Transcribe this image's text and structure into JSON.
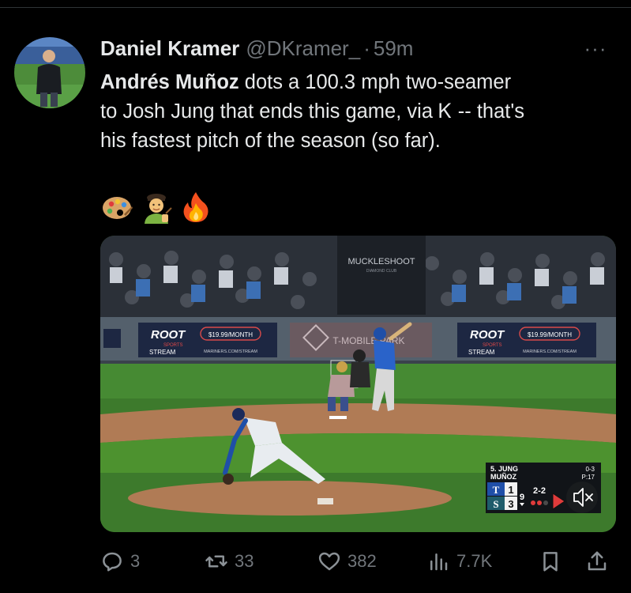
{
  "tweet": {
    "display_name": "Daniel Kramer",
    "handle": "@DKramer_",
    "separator": "·",
    "time": "59m",
    "more_label": "···",
    "text_lines": [
      {
        "bold": "Andrés Muñoz",
        "rest": " dots a 100.3 mph two-seamer"
      },
      {
        "bold": "",
        "rest": "to Josh Jung that ends this game, via Ꮶ -- that's"
      },
      {
        "bold": "",
        "rest": "his fastest pitch of the season (so far)."
      }
    ],
    "emojis": [
      "artist-palette-emoji",
      "artist-emoji",
      "fire-emoji"
    ]
  },
  "media": {
    "stadium_sign": "MUCKLESHOOT",
    "stadium_sign_sub": "DIAMOND CLUB",
    "ad_left_brand": "ROOT",
    "ad_left_sub": "SPORTS",
    "ad_left_stream": "STREAM",
    "ad_price": "$19.99/MONTH",
    "ad_url": "MARINERS.COM/STREAM",
    "ad_park": "T-MOBILE PARK",
    "ad_right_brand": "ROOT",
    "ad_right_sub": "SPORTS",
    "ad_right_stream": "STREAM",
    "scorebug": {
      "batter": "5. JUNG",
      "pitcher": "MUÑOZ",
      "batter_stat": "0-3",
      "pitch_count": "P:17",
      "team1": "T",
      "team1_score": "1",
      "team2": "S",
      "team2_score": "3",
      "inning": "9",
      "count": "2-2"
    }
  },
  "actions": {
    "replies": "3",
    "retweets": "33",
    "likes": "382",
    "views": "7.7K"
  }
}
